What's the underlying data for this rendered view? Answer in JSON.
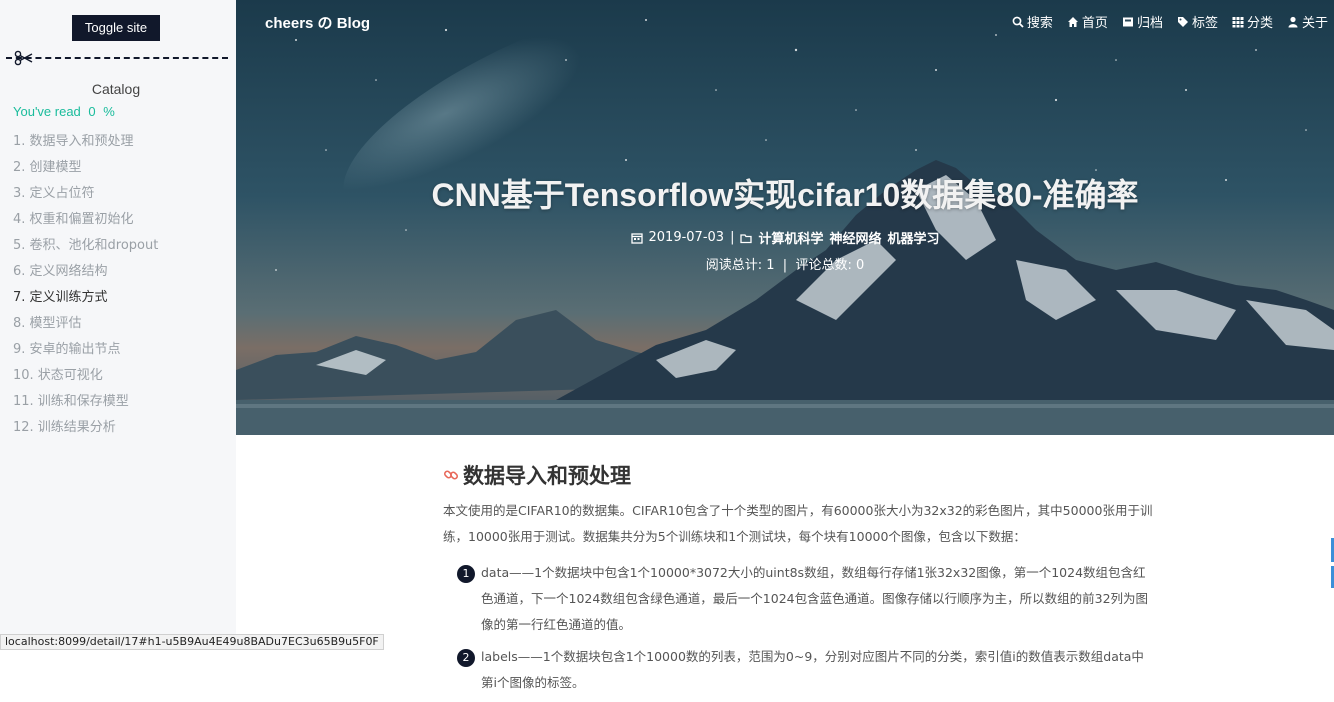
{
  "sidebar": {
    "toggle_label": "Toggle site",
    "catalog_title": "Catalog",
    "read_prefix": "You've read",
    "read_value": "0",
    "read_suffix": "%",
    "items": [
      "1. 数据导入和预处理",
      "2. 创建模型",
      "3. 定义占位符",
      "4. 权重和偏置初始化",
      "5. 卷积、池化和dropout",
      "6. 定义网络结构",
      "7. 定义训练方式",
      "8. 模型评估",
      "9. 安卓的输出节点",
      "10. 状态可视化",
      "11. 训练和保存模型",
      "12. 训练结果分析"
    ],
    "active_index": 6
  },
  "header": {
    "brand": "cheers の Blog",
    "nav": [
      {
        "label": "搜索",
        "icon": "search-icon"
      },
      {
        "label": "首页",
        "icon": "home-icon"
      },
      {
        "label": "归档",
        "icon": "archive-icon"
      },
      {
        "label": "标签",
        "icon": "tags-icon"
      },
      {
        "label": "分类",
        "icon": "grid-icon"
      },
      {
        "label": "关于",
        "icon": "user-icon"
      }
    ]
  },
  "post": {
    "title": "CNN基于Tensorflow实现cifar10数据集80-准确率",
    "date": "2019-07-03",
    "separator": "|",
    "tags": [
      "计算机科学",
      "神经网络",
      "机器学习"
    ],
    "views_label": "阅读总计: 1",
    "comments_label": "评论总数: 0"
  },
  "article": {
    "heading": "数据导入和预处理",
    "intro": "本文使用的是CIFAR10的数据集。CIFAR10包含了十个类型的图片，有60000张大小为32x32的彩色图片，其中50000张用于训练，10000张用于测试。数据集共分为5个训练块和1个测试块，每个块有10000个图像，包含以下数据：",
    "list": [
      {
        "num": "1",
        "text": "data——1个数据块中包含1个10000*3072大小的uint8s数组，数组每行存储1张32x32图像，第一个1024数组包含红色通道，下一个1024数组包含绿色通道，最后一个1024包含蓝色通道。图像存储以行顺序为主，所以数组的前32列为图像的第一行红色通道的值。"
      },
      {
        "num": "2",
        "text": "labels——1个数据块包含1个10000数的列表，范围为0~9，分别对应图片不同的分类，索引值i的数值表示数组data中第i个图像的标签。"
      }
    ]
  },
  "status": {
    "url": "localhost:8099/detail/17#h1-u5B9Au4E49u8BADu7EC3u65B9u5F0F"
  },
  "colors": {
    "accent": "#1abc9c",
    "dark": "#11182b",
    "link_icon": "#e8685a"
  }
}
